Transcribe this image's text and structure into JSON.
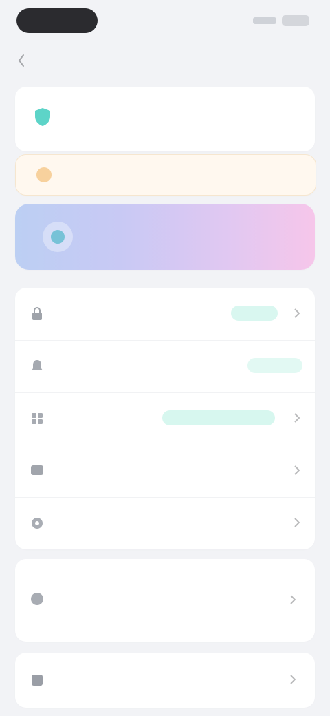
{
  "status_bar": {
    "signal_icon": "signal-icon",
    "battery_icon": "battery-icon"
  },
  "nav": {
    "title": "",
    "back_icon": "chevron-left-icon"
  },
  "account": {
    "icon": "shield-icon",
    "name": "",
    "subtitle": "",
    "accent_color": "#27c6b6"
  },
  "notice": {
    "icon": "warning-icon",
    "text": "",
    "color": "#f4c07a"
  },
  "promo": {
    "icon": "cloud-icon",
    "title": "",
    "subtitle": "",
    "gradient": [
      "#bccff3",
      "#f6c6ea"
    ]
  },
  "settings_list": [
    {
      "icon": "lock-icon",
      "label": "",
      "badge": "",
      "badge_color": "#2fd1b2"
    },
    {
      "icon": "bell-icon",
      "label": "",
      "badge": "",
      "badge_color": "#2fd1b2"
    },
    {
      "icon": "grid-icon",
      "label": "",
      "badge": "",
      "badge_color": "#2fd1b2"
    },
    {
      "icon": "message-icon",
      "label": "",
      "badge": ""
    },
    {
      "icon": "settings-icon",
      "label": "",
      "badge": ""
    }
  ],
  "faq": {
    "icon": "help-icon",
    "title": "",
    "subtitle": ""
  },
  "about": {
    "icon": "info-icon",
    "label": ""
  }
}
